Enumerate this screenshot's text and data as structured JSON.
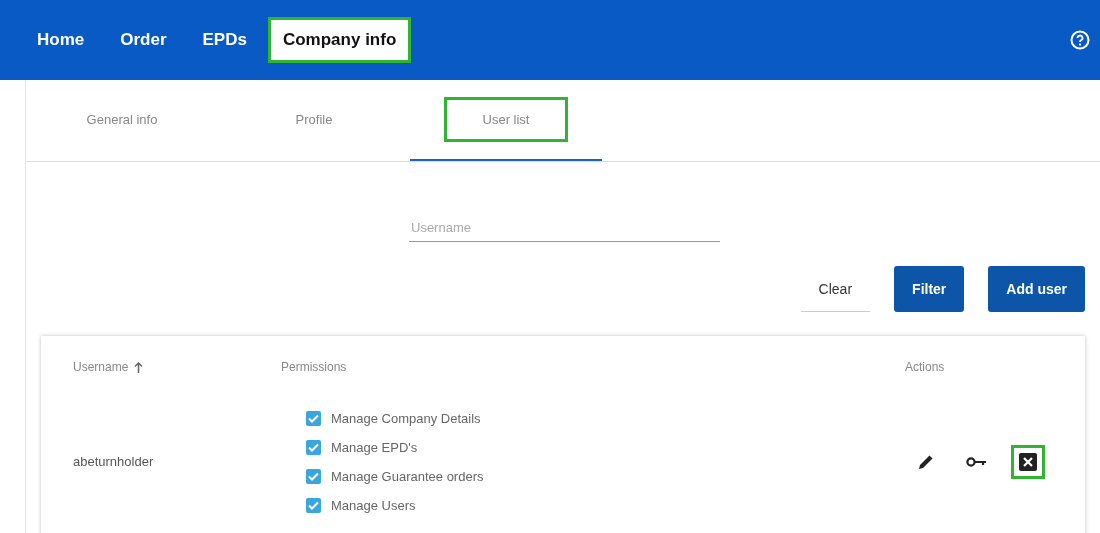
{
  "nav": {
    "items": [
      {
        "label": "Home",
        "selected": false,
        "highlighted": false
      },
      {
        "label": "Order",
        "selected": false,
        "highlighted": false
      },
      {
        "label": "EPDs",
        "selected": false,
        "highlighted": false
      },
      {
        "label": "Company info",
        "selected": true,
        "highlighted": true
      }
    ]
  },
  "tabs": [
    {
      "label": "General info",
      "selected": false,
      "highlighted": false
    },
    {
      "label": "Profile",
      "selected": false,
      "highlighted": false
    },
    {
      "label": "User list",
      "selected": true,
      "highlighted": true
    }
  ],
  "search": {
    "placeholder": "Username"
  },
  "buttons": [
    {
      "label": "Clear",
      "kind": "flat"
    },
    {
      "label": "Filter",
      "kind": "primary"
    },
    {
      "label": "Add user",
      "kind": "primary"
    }
  ],
  "table": {
    "columns": [
      {
        "label": "Username",
        "sorted": true
      },
      {
        "label": "Permissions",
        "sorted": false
      },
      {
        "label": "Actions",
        "sorted": false
      }
    ],
    "rows": [
      {
        "username": "abeturnholder",
        "permissions": [
          {
            "label": "Manage Company Details",
            "checked": true
          },
          {
            "label": "Manage EPD's",
            "checked": true
          },
          {
            "label": "Manage Guarantee orders",
            "checked": true
          },
          {
            "label": "Manage Users",
            "checked": true
          }
        ],
        "actions": [
          {
            "kind": "edit",
            "highlighted": false
          },
          {
            "kind": "key",
            "highlighted": false
          },
          {
            "kind": "delete",
            "highlighted": true
          }
        ]
      }
    ]
  }
}
